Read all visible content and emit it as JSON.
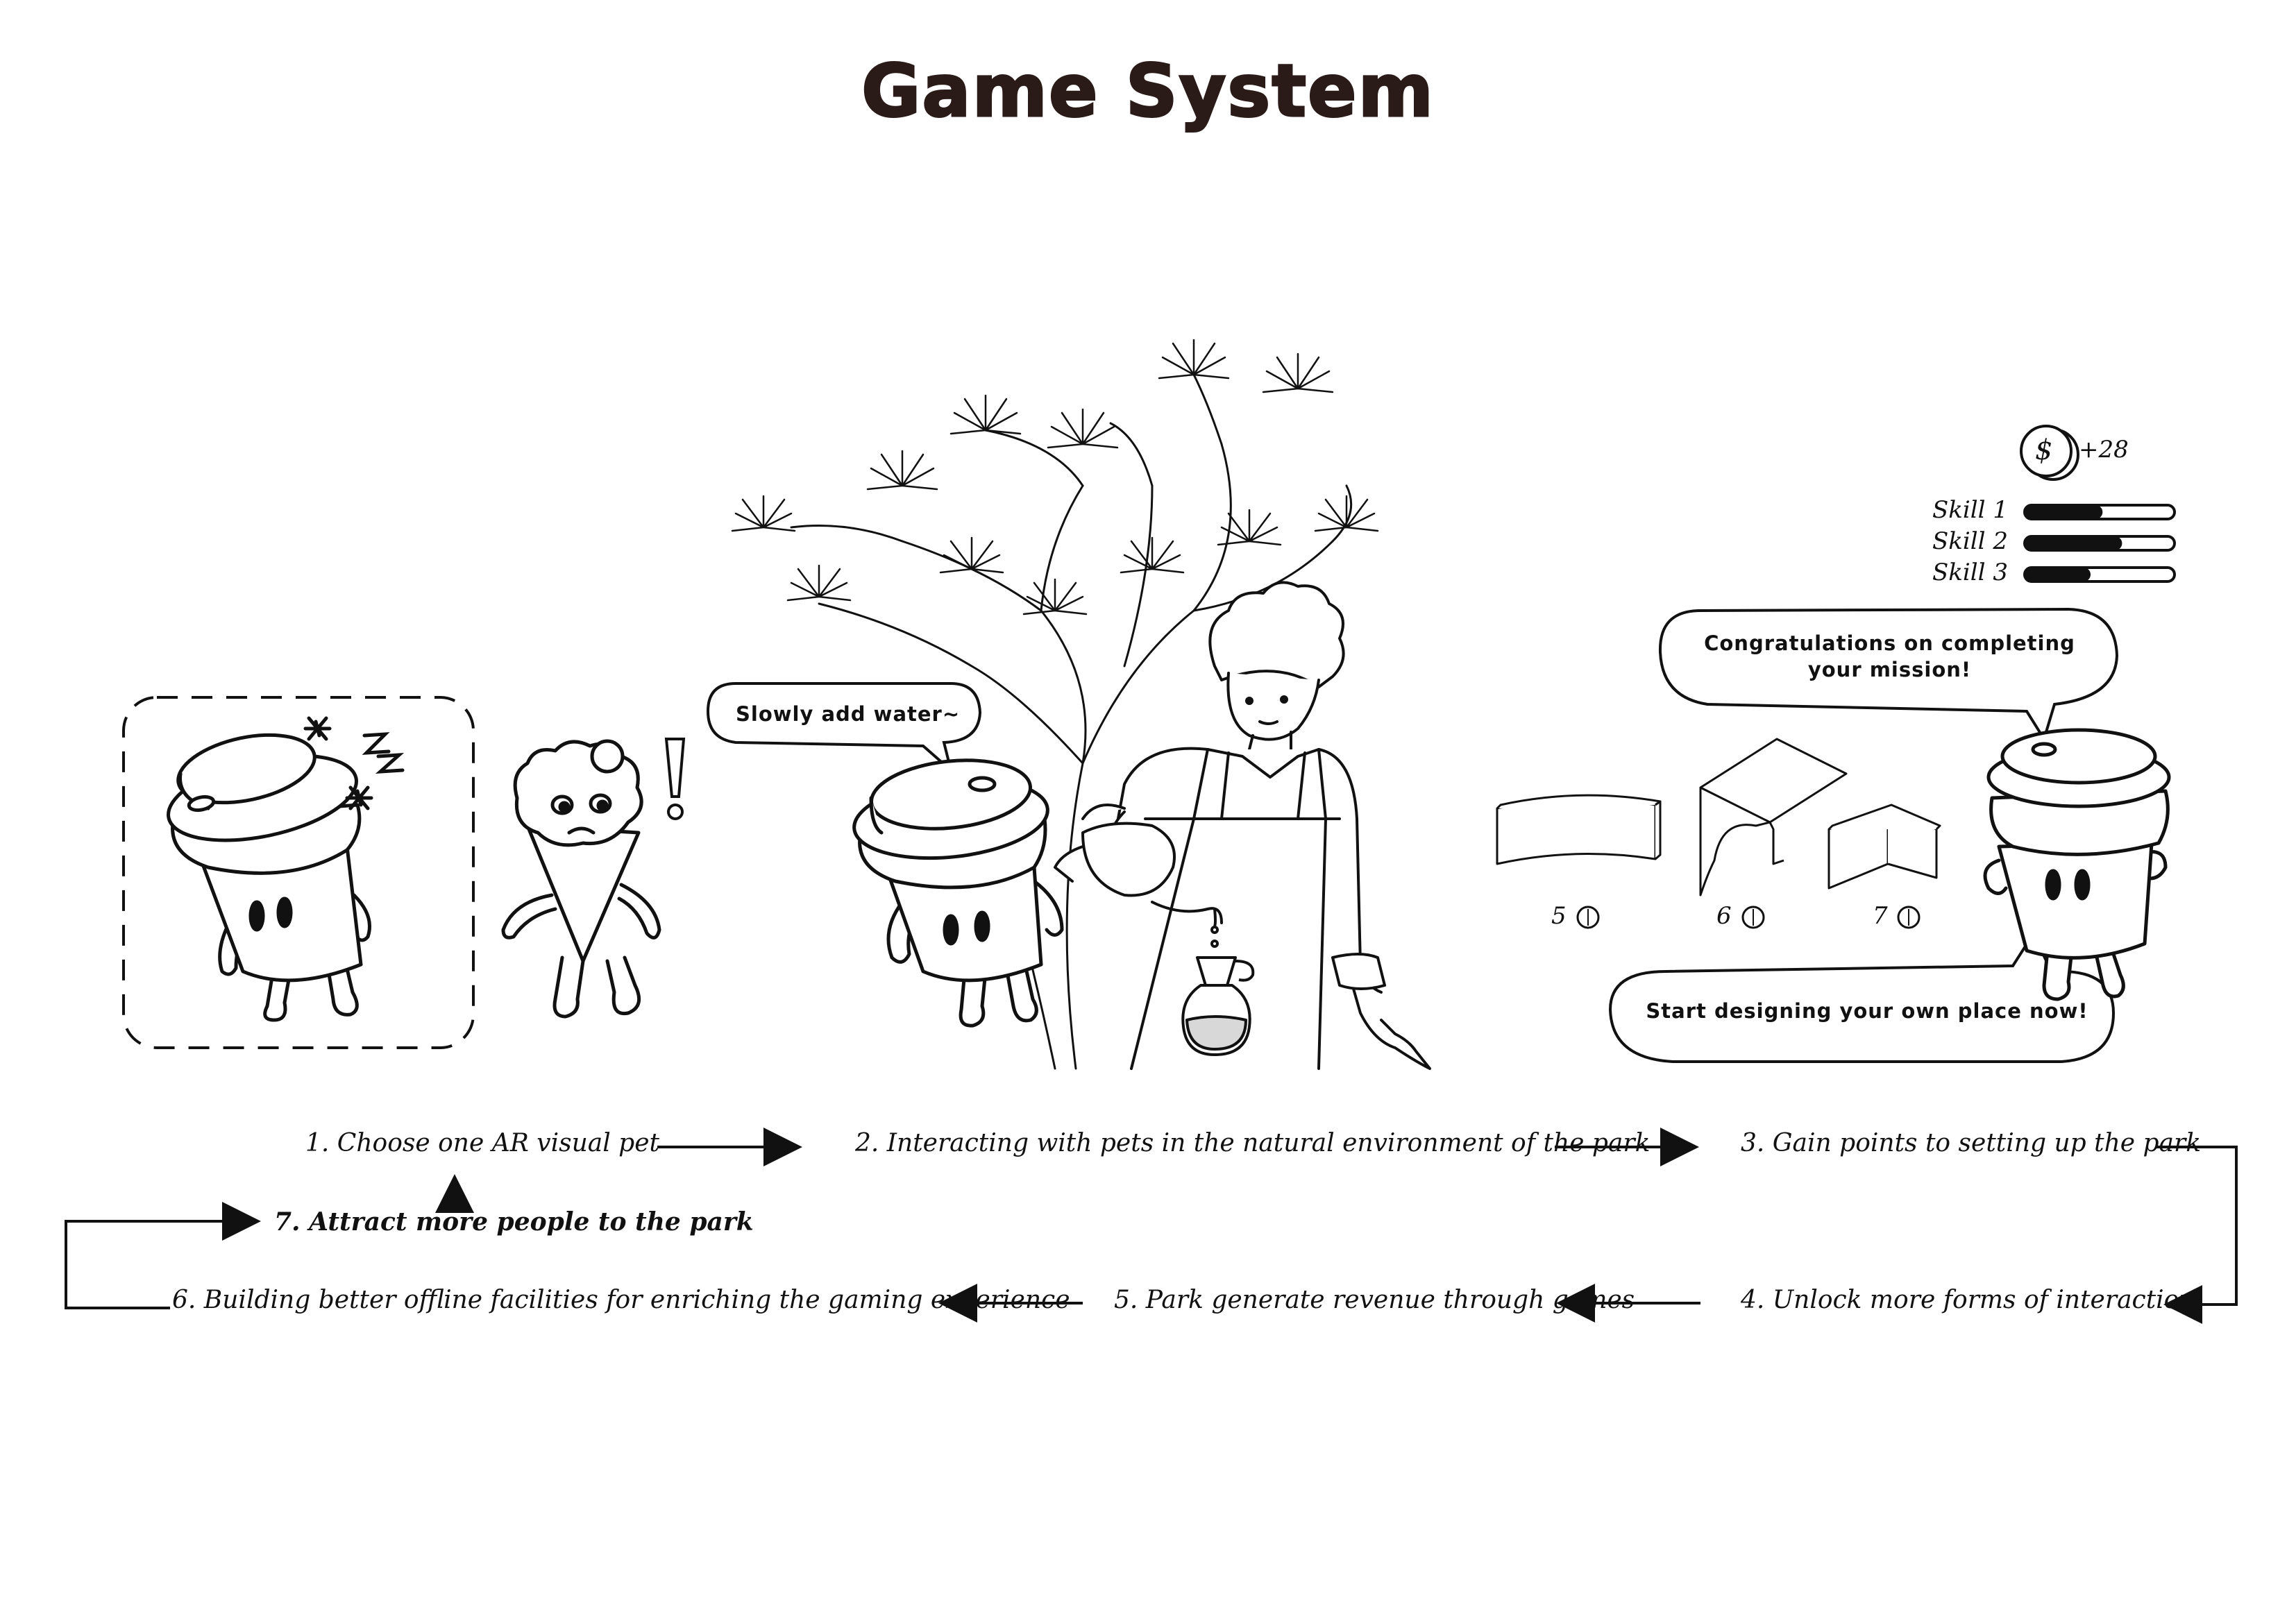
{
  "title": "Game System",
  "bubbles": {
    "water": "Slowly add water~",
    "congrats_line1": "Congratulations on completing",
    "congrats_line2": "your mission!",
    "design": "Start designing your own place now!"
  },
  "hud": {
    "coin_symbol": "$",
    "coin_gain": "+28",
    "skills": [
      {
        "label": "Skill 1",
        "level": 0.52
      },
      {
        "label": "Skill 2",
        "level": 0.65
      },
      {
        "label": "Skill 3",
        "level": 0.44
      }
    ]
  },
  "facilities": [
    {
      "price": "5"
    },
    {
      "price": "6"
    },
    {
      "price": "7"
    }
  ],
  "steps": {
    "s1": "1. Choose one AR visual pet",
    "s2": "2. Interacting with pets in the natural environment of the park",
    "s3": "3. Gain points to setting up the park",
    "s4": "4. Unlock more forms of interaction",
    "s5": "5. Park generate revenue through games",
    "s6": "6. Building better offline facilities for enriching the gaming experience",
    "s7": "7. Attract more people to the park"
  },
  "icons": {
    "coin": "dollar-coin-icon",
    "sleep": "zzz-icon",
    "alert": "exclamation-icon"
  }
}
